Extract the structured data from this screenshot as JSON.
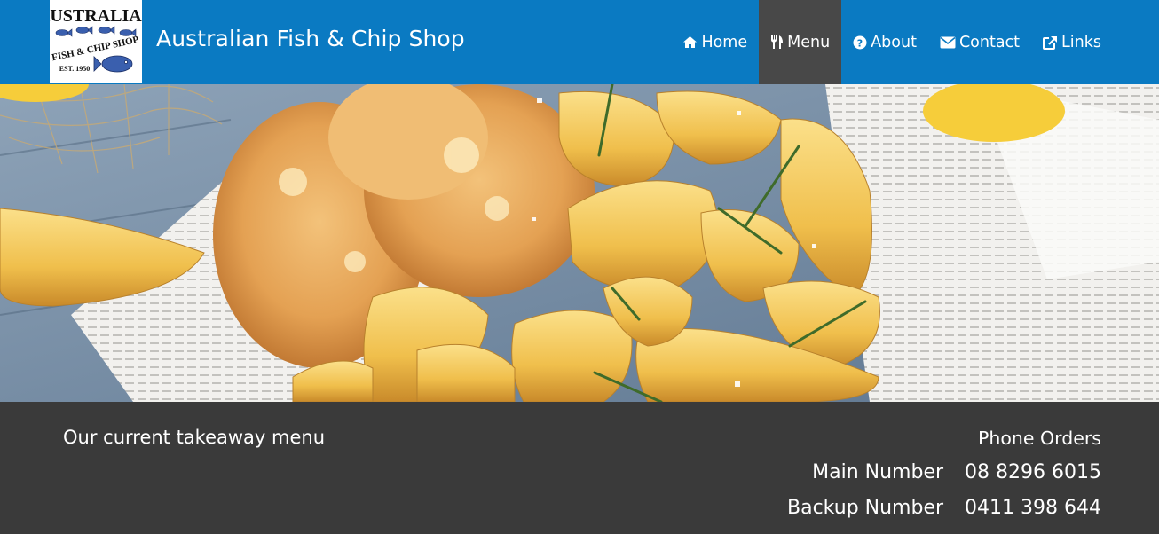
{
  "site": {
    "title": "Australian Fish & Chip Shop",
    "logo": {
      "line1": "AUSTRALIAN",
      "line2": "FISH & CHIP SHOP",
      "est": "EST. 1950"
    }
  },
  "nav": {
    "items": [
      {
        "label": "Home",
        "icon": "home-icon",
        "active": false
      },
      {
        "label": "Menu",
        "icon": "cutlery-icon",
        "active": true
      },
      {
        "label": "About",
        "icon": "question-circle-icon",
        "active": false
      },
      {
        "label": "Contact",
        "icon": "envelope-icon",
        "active": false
      },
      {
        "label": "Links",
        "icon": "external-link-icon",
        "active": false
      }
    ]
  },
  "footer": {
    "menu_text": "Our current takeaway menu",
    "phone_heading": "Phone Orders",
    "phones": [
      {
        "label": "Main Number",
        "number": "08 8296 6015"
      },
      {
        "label": "Backup Number",
        "number": "0411 398 644"
      }
    ]
  },
  "colors": {
    "navbar": "#0a7ac2",
    "active_nav": "#484848",
    "footer": "#3a3a3a"
  }
}
